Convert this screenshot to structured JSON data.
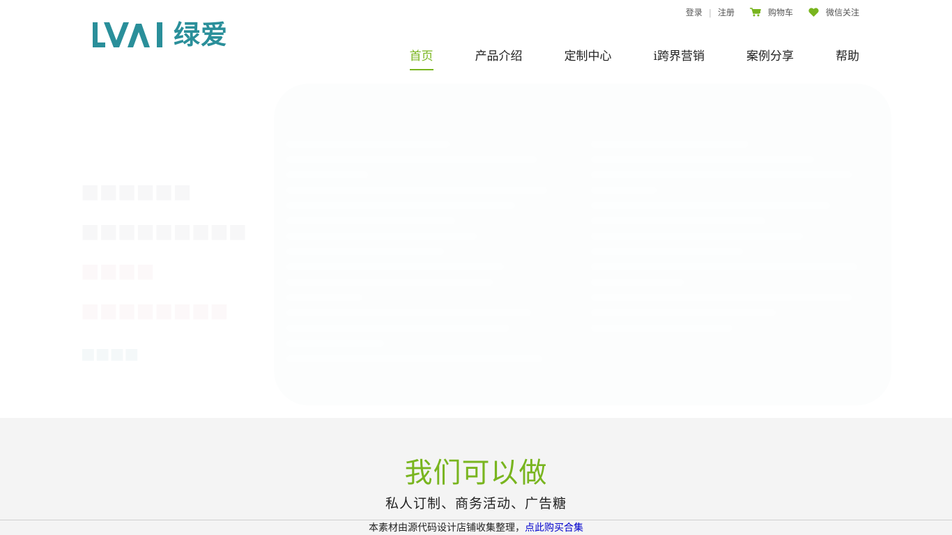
{
  "brand": {
    "logo_latin": "LVAI",
    "logo_cn": "绿爱",
    "color": "#2a8f9a"
  },
  "topbar": {
    "login": "登录",
    "register": "注册",
    "cart": "购物车",
    "wechat": "微信关注",
    "cart_icon": "cart-icon",
    "wechat_icon": "heart-icon"
  },
  "nav": {
    "accent": "#79b51f",
    "items": [
      {
        "label": "首页",
        "active": true
      },
      {
        "label": "产品介绍",
        "active": false
      },
      {
        "label": "定制中心",
        "active": false
      },
      {
        "label": "i跨界营销",
        "active": false
      },
      {
        "label": "案例分享",
        "active": false
      },
      {
        "label": "帮助",
        "active": false
      }
    ]
  },
  "section": {
    "title": "我们可以做",
    "subtitle": "私人订制、商务活动、广告糖"
  },
  "notice": {
    "text": "本素材由源代码设计店铺收集整理，",
    "link": "点此购买合集"
  }
}
